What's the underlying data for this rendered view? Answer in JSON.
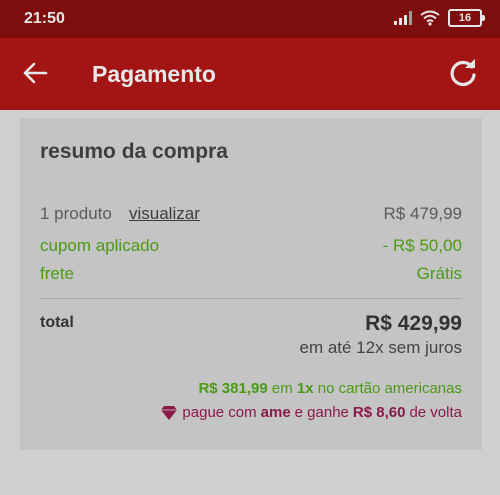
{
  "status": {
    "time": "21:50",
    "battery": "16"
  },
  "appbar": {
    "title": "Pagamento"
  },
  "summary": {
    "title": "resumo da compra",
    "product_label": "1 produto",
    "product_link": "visualizar",
    "product_price": "R$ 479,99",
    "coupon_label": "cupom aplicado",
    "coupon_value": "- R$ 50,00",
    "shipping_label": "frete",
    "shipping_value": "Grátis",
    "total_label": "total",
    "total_value": "R$ 429,99",
    "installments": "em até 12x sem juros",
    "promo_card": {
      "amount": "R$ 381,99",
      "text1": "em",
      "times": "1x",
      "text2": "no cartão americanas"
    },
    "promo_ame": {
      "text1": "pague com",
      "brand": "ame",
      "text2": "e ganhe",
      "cashback": "R$ 8,60",
      "text3": "de volta"
    }
  },
  "colors": {
    "statusbar": "#7e0d0d",
    "appbar": "#a31414",
    "green": "#4c9a15",
    "ame": "#8b1a4a"
  },
  "icons": {
    "back": "arrow-left-icon",
    "refresh": "refresh-icon",
    "signal": "signal-icon",
    "wifi": "wifi-icon",
    "battery": "battery-icon",
    "ame": "heart-gem-icon"
  }
}
